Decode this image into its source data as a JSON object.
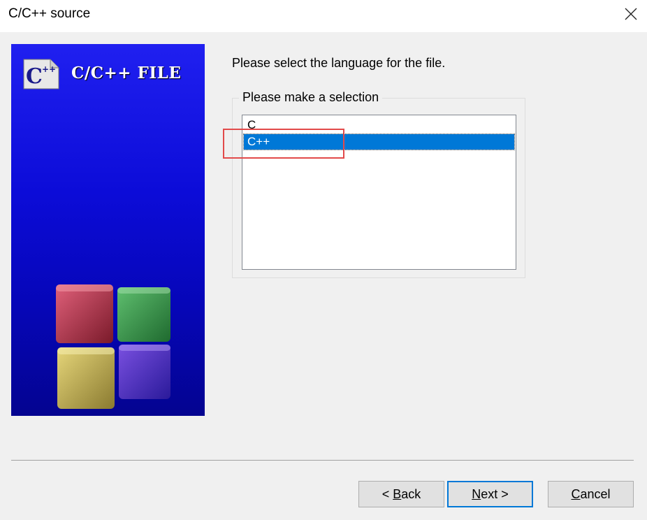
{
  "window": {
    "title": "C/C++ source"
  },
  "banner": {
    "title": "C/C++ FILE",
    "icon": "c-plus-plus-file-icon"
  },
  "main": {
    "prompt": "Please select the language for the file.",
    "group_label": "Please make a selection",
    "list_items": [
      {
        "label": "C",
        "selected": false
      },
      {
        "label": "C++",
        "selected": true
      }
    ]
  },
  "buttons": {
    "back": {
      "prefix": "< ",
      "accel": "B",
      "rest": "ack"
    },
    "next": {
      "prefix": "",
      "accel": "N",
      "rest": "ext >"
    },
    "cancel": {
      "prefix": "",
      "accel": "C",
      "rest": "ancel"
    }
  },
  "colors": {
    "selection": "#0078d7",
    "annotation": "#e24a4a",
    "banner_top": "#2020f0",
    "banner_bottom": "#040490"
  }
}
